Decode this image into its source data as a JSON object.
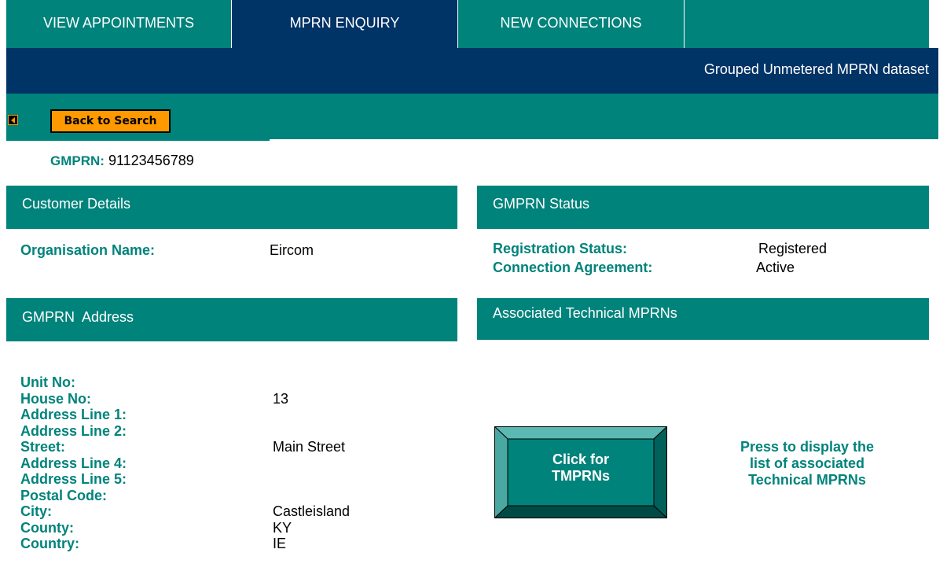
{
  "tabs": [
    {
      "label": "VIEW APPOINTMENTS",
      "active": false
    },
    {
      "label": "MPRN ENQUIRY",
      "active": true
    },
    {
      "label": "NEW CONNECTIONS",
      "active": false
    }
  ],
  "subheader": {
    "dataset_label": "Grouped Unmetered MPRN dataset"
  },
  "toolbar": {
    "back_label": "Back to Search",
    "back_icon": "left-arrow-icon"
  },
  "gmprn": {
    "label": "GMPRN:",
    "value": "91123456789"
  },
  "customer_details": {
    "title": "Customer Details",
    "organisation_label": "Organisation Name:",
    "organisation_value": "Eircom"
  },
  "status": {
    "title": "GMPRN Status",
    "registration_label": "Registration Status:",
    "registration_value": "Registered",
    "connection_label": "Connection Agreement:",
    "connection_value": "Active"
  },
  "address": {
    "title": "GMPRN  Address",
    "fields": [
      {
        "label": "Unit No:",
        "value": ""
      },
      {
        "label": "House No:",
        "value": "13"
      },
      {
        "label": "Address Line 1:",
        "value": ""
      },
      {
        "label": "Address Line 2:",
        "value": ""
      },
      {
        "label": "Street:",
        "value": "Main Street"
      },
      {
        "label": "Address Line 4:",
        "value": ""
      },
      {
        "label": "Address Line 5:",
        "value": ""
      },
      {
        "label": "Postal Code:",
        "value": ""
      },
      {
        "label": "City:",
        "value": "Castleisland"
      },
      {
        "label": "County:",
        "value": "KY"
      },
      {
        "label": "Country:",
        "value": "IE"
      }
    ]
  },
  "technical": {
    "title": "Associated Technical MPRNs",
    "button_line1": "Click for",
    "button_line2": "TMPRNs",
    "hint_line1": "Press to display the",
    "hint_line2": "list of associated",
    "hint_line3": "Technical MPRNs"
  },
  "colors": {
    "teal": "#00837b",
    "navy": "#003366",
    "orange": "#ff9900"
  }
}
